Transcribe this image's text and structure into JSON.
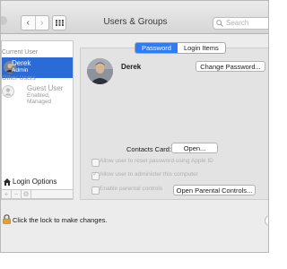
{
  "window": {
    "title": "Users & Groups",
    "search_placeholder": "Search"
  },
  "sidebar": {
    "current_header": "Current User",
    "current_user": {
      "name": "Derek",
      "role": "Admin"
    },
    "other_header": "Other Users",
    "guest_user": {
      "name": "Guest User",
      "role": "Enabled, Managed"
    },
    "login_options": "Login Options",
    "buttons": [
      "+",
      "−",
      "⚙"
    ]
  },
  "tabs": [
    {
      "label": "Password",
      "active": true
    },
    {
      "label": "Login Items",
      "active": false
    }
  ],
  "profile": {
    "name": "Derek",
    "change_password": "Change Password..."
  },
  "contacts": {
    "label": "Contacts Card:",
    "open": "Open..."
  },
  "checkboxes": [
    {
      "label": "Allow user to reset password using Apple ID",
      "checked": false
    },
    {
      "label": "Allow user to administer this computer",
      "checked": true
    },
    {
      "label": "Enable parental controls",
      "checked": false
    }
  ],
  "parental_button": "Open Parental Controls...",
  "lock": {
    "text": "Click the lock to make changes."
  },
  "colors": {
    "selection": "#2b6bd8",
    "tab_active": "#2f7cf6"
  }
}
